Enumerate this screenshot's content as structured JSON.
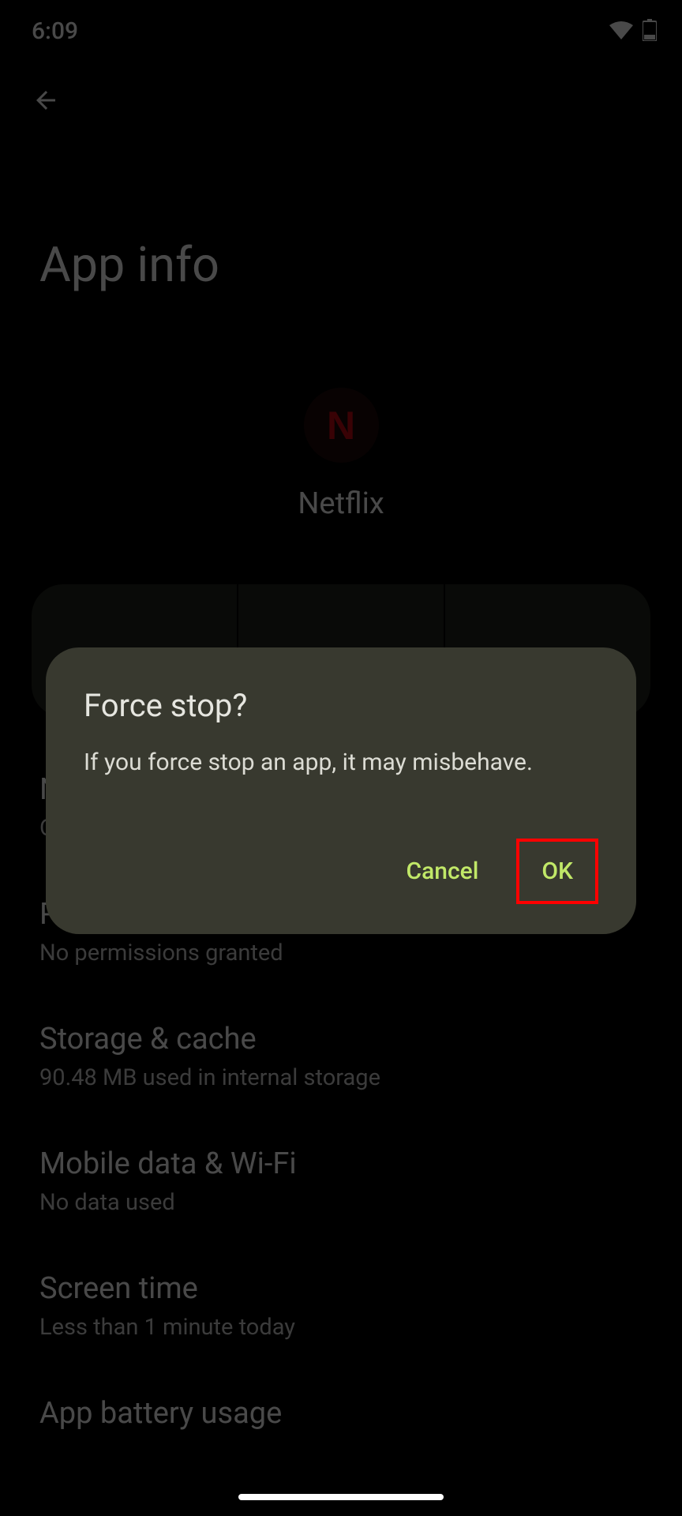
{
  "statusBar": {
    "time": "6:09"
  },
  "header": {
    "title": "App info",
    "appName": "Netflix",
    "appIconLetter": "N"
  },
  "settingsList": [
    {
      "title": "Notifications",
      "subtitle": "On"
    },
    {
      "title": "Permissions",
      "subtitle": "No permissions granted"
    },
    {
      "title": "Storage & cache",
      "subtitle": "90.48 MB used in internal storage"
    },
    {
      "title": "Mobile data & Wi-Fi",
      "subtitle": "No data used"
    },
    {
      "title": "Screen time",
      "subtitle": "Less than 1 minute today"
    },
    {
      "title": "App battery usage",
      "subtitle": ""
    }
  ],
  "dialog": {
    "title": "Force stop?",
    "message": "If you force stop an app, it may misbehave.",
    "cancelLabel": "Cancel",
    "okLabel": "OK"
  }
}
